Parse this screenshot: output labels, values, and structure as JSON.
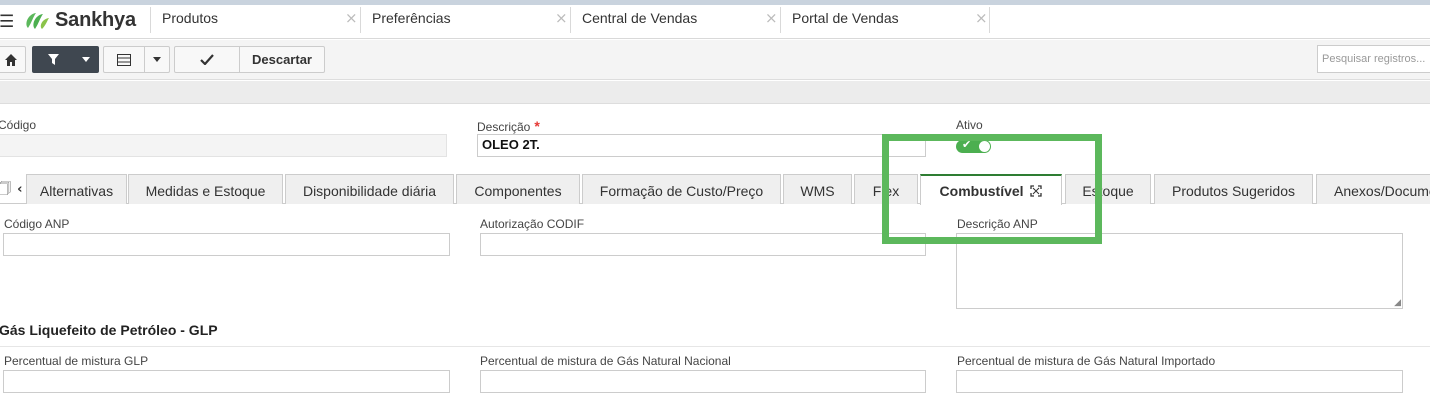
{
  "app": {
    "brand": "Sankhya",
    "brand_color": "#4caf50"
  },
  "tabs": [
    {
      "label": "Produtos",
      "active": true
    },
    {
      "label": "Preferências"
    },
    {
      "label": "Central de Vendas"
    },
    {
      "label": "Portal de Vendas"
    }
  ],
  "toolbar": {
    "home_icon": "home-icon",
    "filter_icon": "filter-icon",
    "grid_icon": "grid-icon",
    "save_icon": "check-icon",
    "discard_label": "Descartar",
    "search_placeholder": "Pesquisar registros..."
  },
  "form": {
    "codigo_label": "Código",
    "codigo_value": "",
    "descricao_label": "Descrição",
    "descricao_value": "OLEO 2T.",
    "ativo_label": "Ativo",
    "ativo_value": true
  },
  "form_tabs": [
    {
      "label": "Alternativas"
    },
    {
      "label": "Medidas e Estoque"
    },
    {
      "label": "Disponibilidade diária"
    },
    {
      "label": "Componentes"
    },
    {
      "label": "Formação de Custo/Preço"
    },
    {
      "label": "WMS"
    },
    {
      "label": "Flex"
    },
    {
      "label": "Combustível",
      "active": true
    },
    {
      "label": "Estoque"
    },
    {
      "label": "Produtos Sugeridos"
    },
    {
      "label": "Anexos/Documentos"
    }
  ],
  "combustivel": {
    "codigo_anp_label": "Código ANP",
    "autorizacao_codif_label": "Autorização CODIF",
    "descricao_anp_label": "Descrição ANP",
    "glp_section_title": "Gás Liquefeito de Petróleo - GLP",
    "perc_glp_label": "Percentual de mistura GLP",
    "perc_gn_nacional_label": "Percentual de mistura de Gás Natural Nacional",
    "perc_gn_importado_label": "Percentual de mistura de Gás Natural Importado"
  }
}
